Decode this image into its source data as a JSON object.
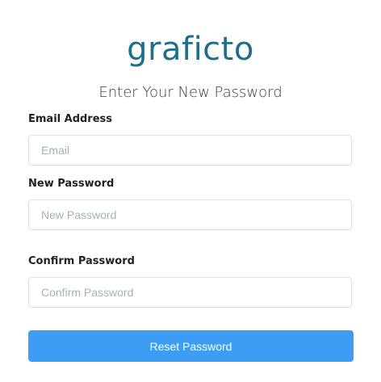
{
  "logo": {
    "text": "graficto",
    "color": "#1f6f8b"
  },
  "heading": "Enter Your New Password",
  "form": {
    "email_label": "Email Address",
    "email_placeholder": "Email",
    "email_value": "",
    "new_password_label": "New Password",
    "new_password_placeholder": "New Password",
    "new_password_value": "",
    "confirm_password_label": "Confirm Password",
    "confirm_password_placeholder": "Confirm Password",
    "confirm_password_value": "",
    "submit_label": "Reset Password"
  },
  "colors": {
    "button": "#3d9df5",
    "input_border": "#dcdfe3"
  }
}
